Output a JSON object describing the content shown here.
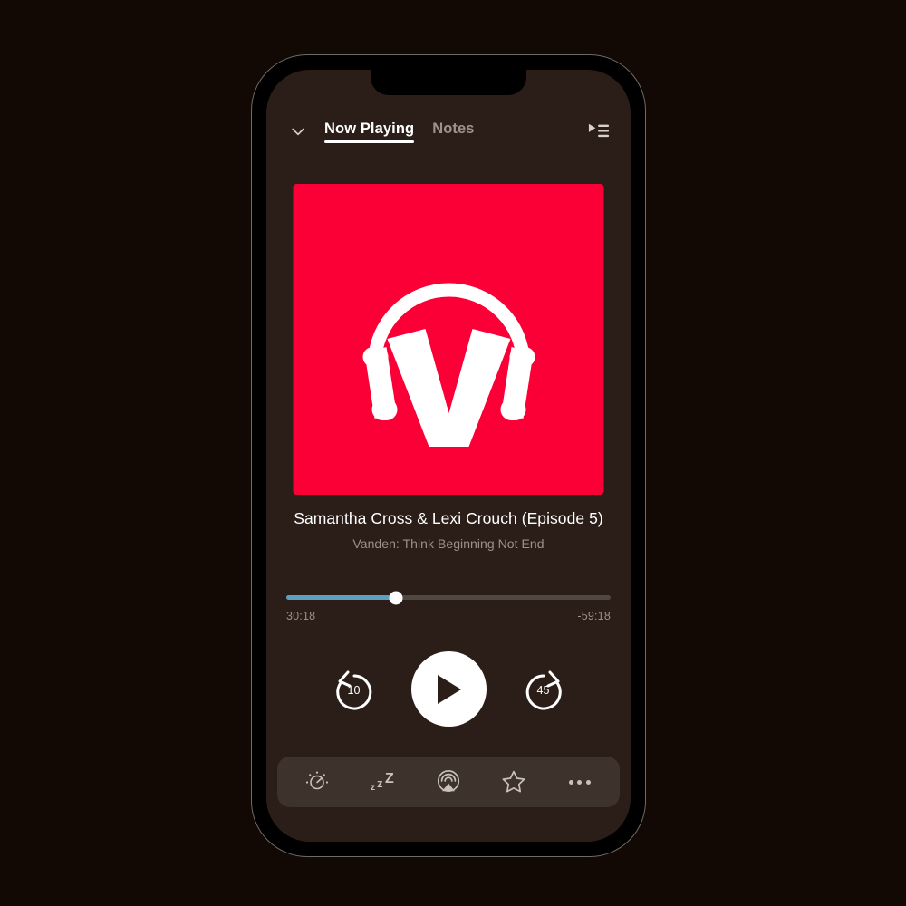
{
  "app": {
    "accent_red": "#fb0036",
    "screen_bg": "#2b1e18",
    "page_bg": "#120905",
    "progress_color": "#5d9ec4",
    "toolbar_bg": "#3d332c"
  },
  "header": {
    "collapse_icon": "chevron-down-icon",
    "tabs": [
      {
        "label": "Now Playing",
        "active": true
      },
      {
        "label": "Notes",
        "active": false
      }
    ],
    "queue_icon": "queue-list-icon"
  },
  "artwork": {
    "alt": "podcast-artwork-v-headphones",
    "background": "#fb0036",
    "logo_letter": "V"
  },
  "nowplaying": {
    "episode_title": "Samantha Cross & Lexi Crouch (Episode 5)",
    "show_title": "Vanden: Think Beginning Not End"
  },
  "progress": {
    "elapsed": "30:18",
    "remaining": "-59:18",
    "percent": 33.8
  },
  "transport": {
    "skip_back_label": "10",
    "skip_back_icon": "rewind-10-icon",
    "play_icon": "play-icon",
    "skip_forward_label": "45",
    "skip_forward_icon": "forward-45-icon"
  },
  "toolbar": {
    "items": [
      {
        "name": "playback-speed-icon",
        "label": "Playback Speed"
      },
      {
        "name": "sleep-timer-icon",
        "label": "Sleep Timer"
      },
      {
        "name": "airplay-icon",
        "label": "AirPlay"
      },
      {
        "name": "star-icon",
        "label": "Star"
      },
      {
        "name": "more-icon",
        "label": "More"
      }
    ]
  }
}
